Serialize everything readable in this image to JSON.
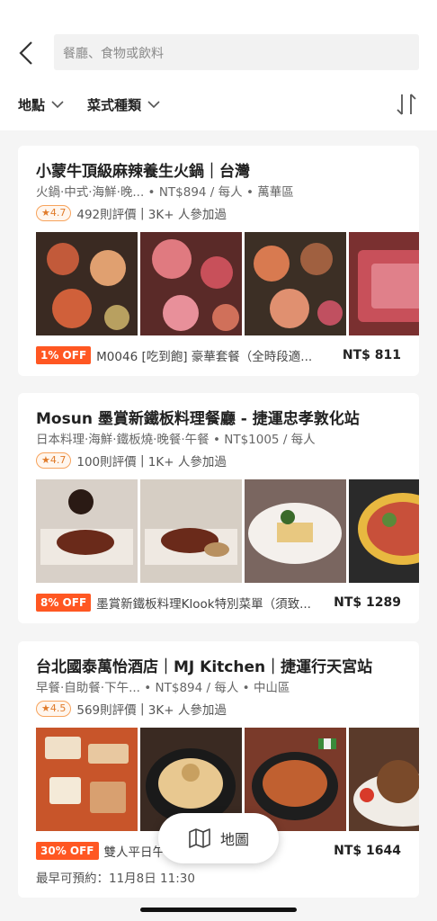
{
  "search": {
    "placeholder": "餐廳、食物或飲料"
  },
  "filters": {
    "location": "地點",
    "cuisine": "菜式種類"
  },
  "restaurants": [
    {
      "name": "小蒙牛頂級麻辣養生火鍋｜台灣",
      "tags": "火鍋·中式·海鮮·晚...",
      "price": "NT$894 / 每人",
      "area": "萬華區",
      "rating": "4.7",
      "reviews": "492則評價",
      "joined": "3K+ 人參加過",
      "offer_badge": "1% OFF",
      "offer_text": "M0046 [吃到飽] 豪華套餐（全時段適...",
      "offer_price": "NT$ 811",
      "photo_colors": [
        "#3a2a22",
        "#5a2a28",
        "#3c2f25",
        "#7a3030"
      ]
    },
    {
      "name": "Mosun 墨賞新鐵板料理餐廳 - 捷運忠孝敦化站",
      "tags": "日本料理·海鮮·鐵板燒·晚餐·午餐",
      "price": "NT$1005 / 每人",
      "area": "",
      "rating": "4.7",
      "reviews": "100則評價",
      "joined": "1K+ 人參加過",
      "offer_badge": "8% OFF",
      "offer_text": "墨賞新鐵板料理Klook特別菜單（須致...",
      "offer_price": "NT$ 1289",
      "photo_colors": [
        "#d8d0c8",
        "#d6cec4",
        "#7a6660",
        "#2a2a2a"
      ]
    },
    {
      "name": "台北國泰萬怡酒店｜MJ Kitchen｜捷運行天宮站",
      "tags": "早餐·自助餐·下午...",
      "price": "NT$894 / 每人",
      "area": "中山區",
      "rating": "4.5",
      "reviews": "569則評價",
      "joined": "3K+ 人參加過",
      "offer_badge": "30% OFF",
      "offer_text": "雙人平日午",
      "offer_price": "NT$ 1644",
      "earliest": "最早可預約：11月8日 11:30",
      "photo_colors": [
        "#c8552a",
        "#3a2a22",
        "#7a3a2a",
        "#5a3a2a"
      ]
    }
  ],
  "map_button": {
    "label": "地圖"
  }
}
